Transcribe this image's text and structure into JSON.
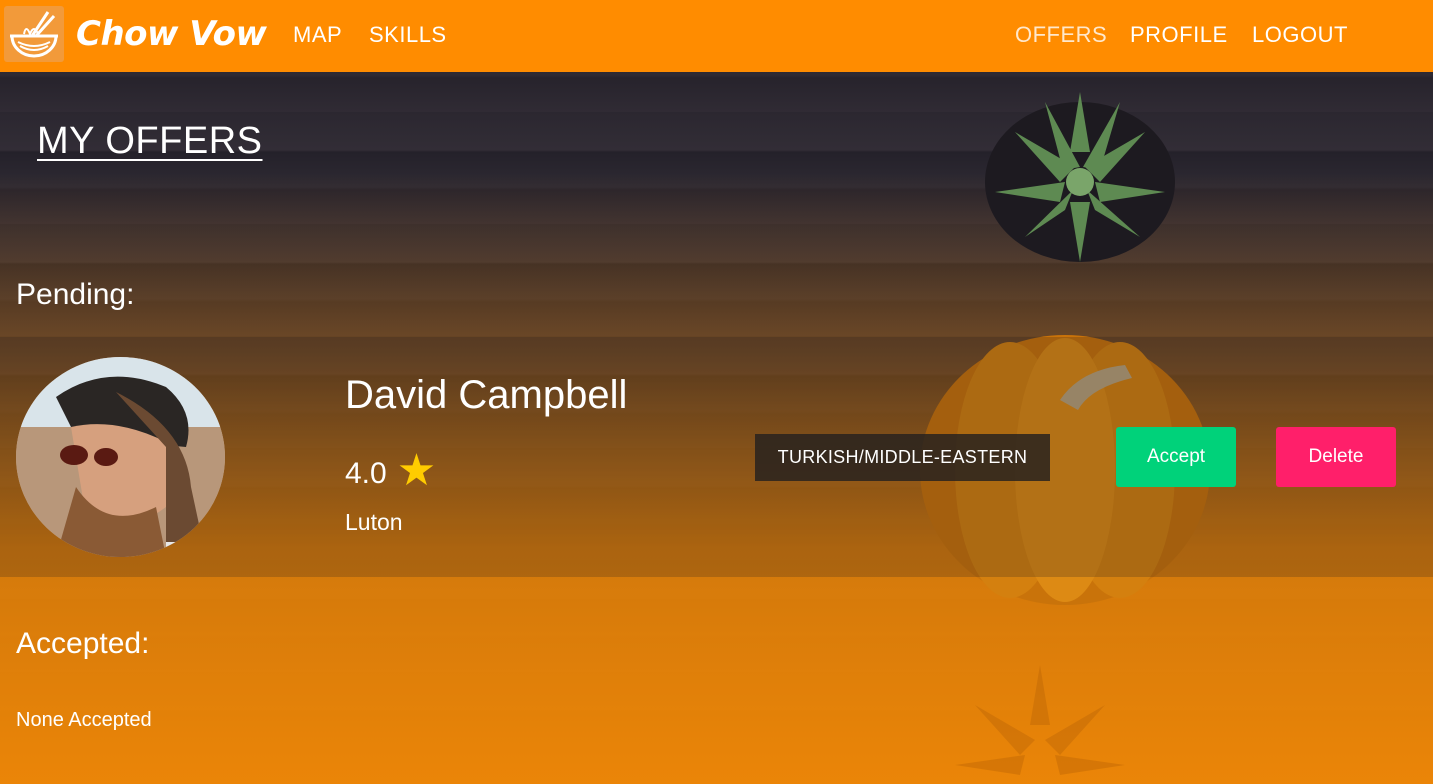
{
  "app": {
    "brand": "Chow Vow",
    "logo_icon": "noodle-bowl-icon",
    "accent_color": "#ff8c00"
  },
  "nav": {
    "left": [
      {
        "label": "MAP"
      },
      {
        "label": "SKILLS"
      }
    ],
    "right": [
      {
        "label": "OFFERS"
      },
      {
        "label": "PROFILE"
      },
      {
        "label": "LOGOUT"
      }
    ]
  },
  "page": {
    "title": "MY OFFERS"
  },
  "pending": {
    "label": "Pending:",
    "items": [
      {
        "name": "David Campbell",
        "rating": "4.0",
        "rating_icon": "star-icon",
        "location": "Luton",
        "cuisine": "TURKISH/MIDDLE-EASTERN",
        "accept_label": "Accept",
        "delete_label": "Delete",
        "accept_color": "#00d27a",
        "delete_color": "#ff1f6a"
      }
    ]
  },
  "accepted": {
    "label": "Accepted:",
    "empty_text": "None Accepted"
  }
}
